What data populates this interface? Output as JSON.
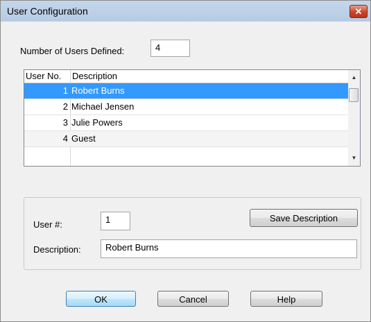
{
  "window": {
    "title": "User Configuration",
    "close_glyph": "✕"
  },
  "num_users": {
    "label": "Number of Users Defined:",
    "value": "4"
  },
  "list": {
    "columns": [
      "User No.",
      "Description"
    ],
    "rows": [
      {
        "no": "1",
        "desc": "Robert Burns",
        "selected": true
      },
      {
        "no": "2",
        "desc": "Michael Jensen",
        "selected": false
      },
      {
        "no": "3",
        "desc": "Julie Powers",
        "selected": false
      },
      {
        "no": "4",
        "desc": "Guest",
        "selected": false
      }
    ],
    "scroll_up": "▲",
    "scroll_down": "▼"
  },
  "edit": {
    "user_label": "User #:",
    "user_value": "1",
    "desc_label": "Description:",
    "desc_value": "Robert Burns",
    "save_button": "Save Description"
  },
  "buttons": {
    "ok": "OK",
    "cancel": "Cancel",
    "help": "Help"
  },
  "colors": {
    "selection": "#3399ff",
    "titlebar": "#c5d6ea"
  }
}
